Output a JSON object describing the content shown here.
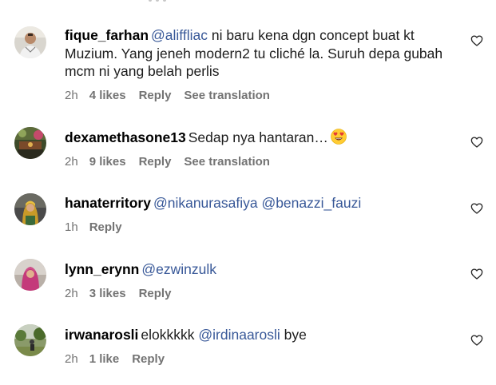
{
  "comments": [
    {
      "username": "fique_farhan",
      "mention": "@aliffliac",
      "text": " ni baru kena dgn concept buat kt Muzium. Yang jeneh modern2 tu cliché la. Suruh depa gubah mcm ni yang belah perlis",
      "time": "2h",
      "likes": "4 likes",
      "reply": "Reply",
      "translate": "See translation"
    },
    {
      "username": "dexamethasone13",
      "text": "Sedap nya hantaran…",
      "emoji": "heart-eyes-emoji",
      "time": "2h",
      "likes": "9 likes",
      "reply": "Reply",
      "translate": "See translation"
    },
    {
      "username": "hanaterritory",
      "mention1": "@nikanurasafiya",
      "mention2": "@benazzi_fauzi",
      "time": "1h",
      "reply": "Reply"
    },
    {
      "username": "lynn_erynn",
      "mention": "@ezwinzulk",
      "time": "2h",
      "likes": "3 likes",
      "reply": "Reply"
    },
    {
      "username": "irwanarosli",
      "text_before": "elokkkkk ",
      "mention": "@irdinaarosli",
      "text_after": " bye",
      "time": "2h",
      "likes": "1 like",
      "reply": "Reply"
    }
  ],
  "colors": {
    "mention": "#385898",
    "meta": "#737373",
    "text": "#1c1c1c"
  },
  "icons": {
    "like": "heart-outline-icon",
    "avatar": "user-avatar-photo"
  }
}
